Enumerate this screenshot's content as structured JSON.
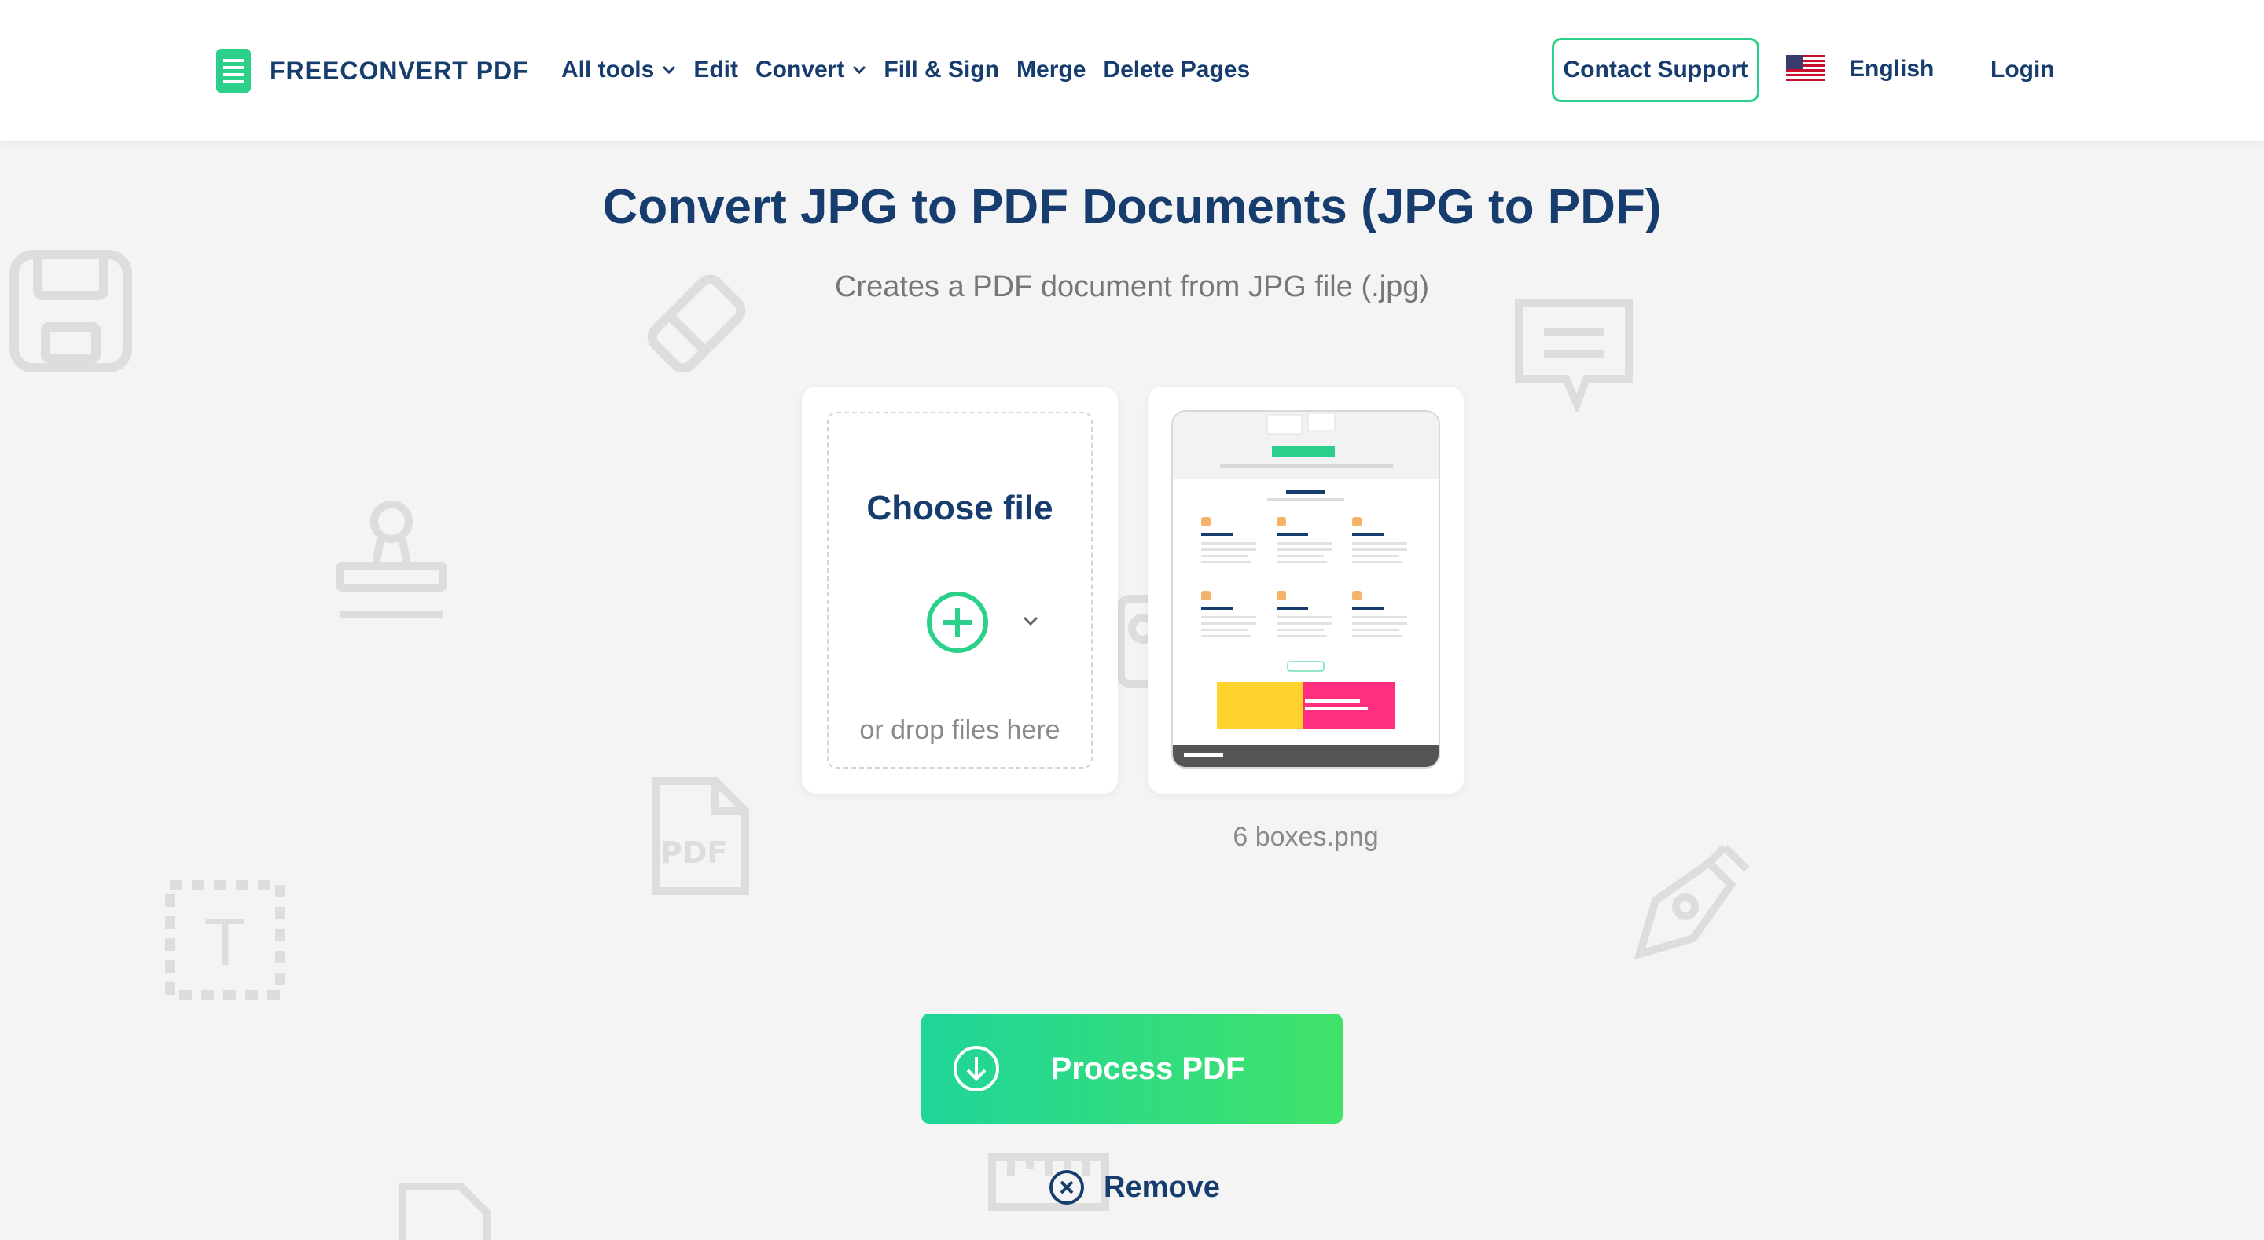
{
  "header": {
    "brand": "FREECONVERT PDF",
    "nav": [
      {
        "label": "All tools",
        "has_dropdown": true
      },
      {
        "label": "Edit",
        "has_dropdown": false
      },
      {
        "label": "Convert",
        "has_dropdown": true
      },
      {
        "label": "Fill & Sign",
        "has_dropdown": false
      },
      {
        "label": "Merge",
        "has_dropdown": false
      },
      {
        "label": "Delete Pages",
        "has_dropdown": false
      }
    ],
    "support_label": "Contact Support",
    "language": "English",
    "login_label": "Login"
  },
  "main": {
    "title": "Convert JPG to PDF Documents (JPG to PDF)",
    "subtitle": "Creates a PDF document from JPG file (.jpg)",
    "choose_file_label": "Choose file",
    "drop_hint": "or drop files here",
    "uploaded_file": "6 boxes.png",
    "process_label": "Process PDF",
    "remove_label": "Remove"
  },
  "colors": {
    "accent": "#2bd18a",
    "primary_text": "#163d6e",
    "button_gradient_start": "#1fd598",
    "button_gradient_end": "#41e26a",
    "background": "#f4f4f4"
  },
  "icons": {
    "logo": "document-list-icon",
    "flag": "us-flag-icon",
    "add": "plus-circle-icon",
    "process": "download-arrow-icon",
    "remove": "close-circle-icon",
    "background": [
      "floppy-disk-icon",
      "eraser-icon",
      "comment-icon",
      "stamp-icon",
      "image-icon",
      "pdf-file-icon",
      "text-box-icon",
      "pen-nib-icon",
      "ruler-icon",
      "file-icon"
    ]
  }
}
